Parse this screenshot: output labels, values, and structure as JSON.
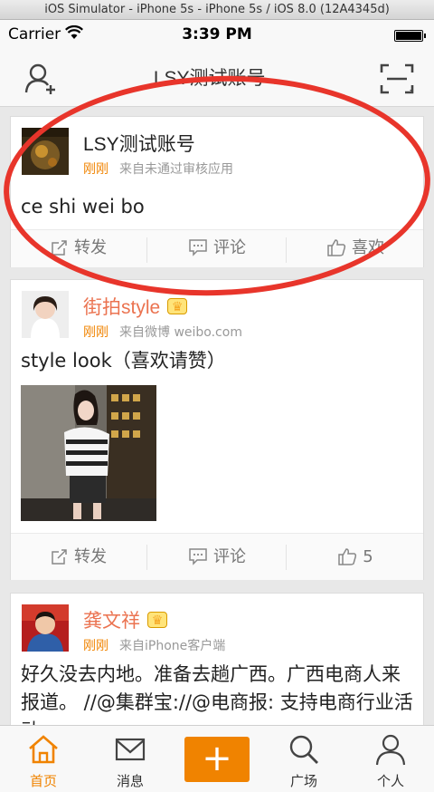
{
  "simulator": {
    "title": "iOS Simulator - iPhone 5s - iPhone 5s / iOS 8.0 (12A4345d)"
  },
  "status_bar": {
    "carrier": "Carrier",
    "time": "3:39 PM"
  },
  "nav": {
    "title": "LSY测试账号",
    "caret": "⌄"
  },
  "posts": [
    {
      "user": "LSY测试账号",
      "time": "刚刚",
      "source": "来自未通过审核应用",
      "text": "ce shi wei bo",
      "repost_label": "转发",
      "comment_label": "评论",
      "like_label": "喜欢"
    },
    {
      "user": "街拍style",
      "time": "刚刚",
      "source": "来自微博 weibo.com",
      "text": "style look（喜欢请赞）",
      "repost_label": "转发",
      "comment_label": "评论",
      "like_count": "5"
    },
    {
      "user": "龚文祥",
      "time": "刚刚",
      "source": "来自iPhone客户端",
      "text": "好久没去内地。准备去趟广西。广西电商人来报道。 //@集群宝://@电商报: 支持电商行业活动。"
    }
  ],
  "tabs": [
    {
      "label": "首页"
    },
    {
      "label": "消息"
    },
    {
      "label": "+"
    },
    {
      "label": "广场"
    },
    {
      "label": "个人"
    }
  ],
  "colors": {
    "accent": "#f08300",
    "annotation": "#e8352b",
    "vip_name": "#eb7350"
  }
}
